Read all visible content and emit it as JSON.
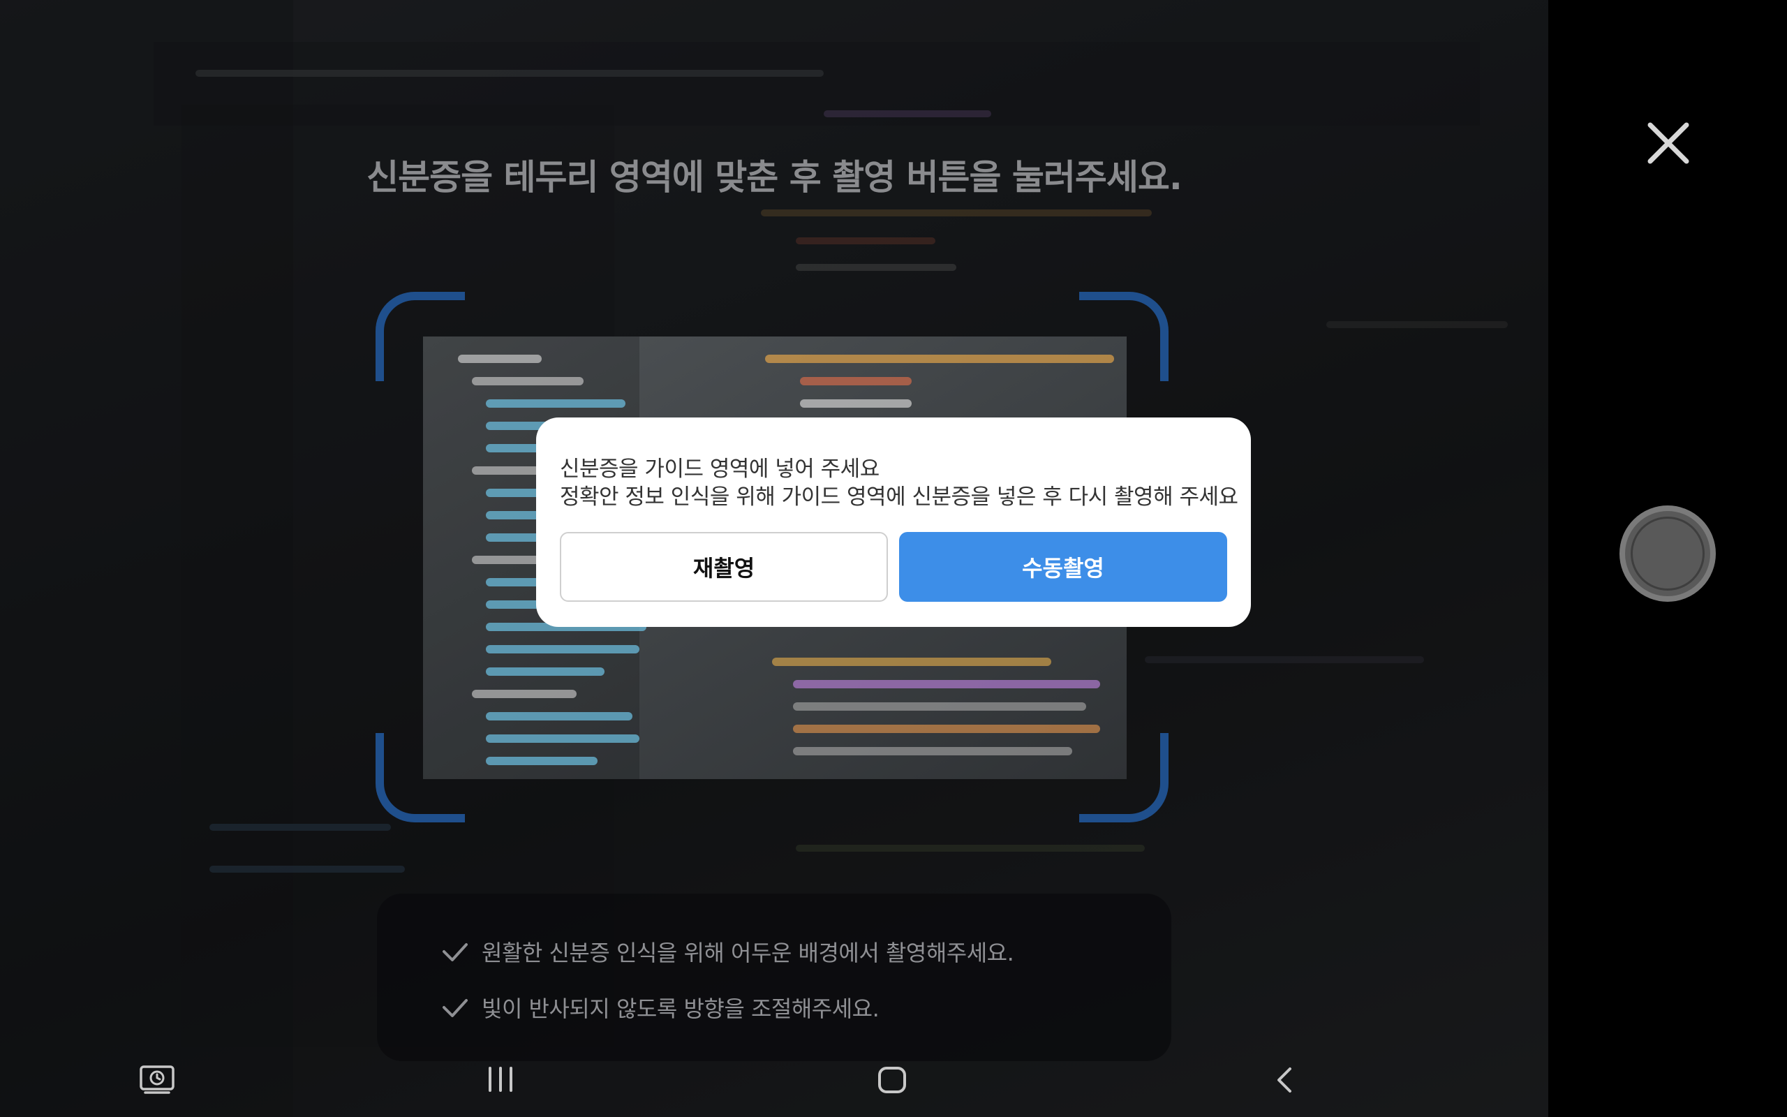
{
  "instruction": "신분증을 테두리 영역에 맞춘 후 촬영 버튼을 눌러주세요.",
  "dialog": {
    "title": "신분증을 가이드 영역에 넣어 주세요",
    "description": "정확안 정보 인식을 위해 가이드 영역에 신분증을 넣은 후 다시 촬영해 주세요",
    "retake_label": "재촬영",
    "manual_label": "수동촬영"
  },
  "tips": [
    "원활한 신분증 인식을 위해 어두운 배경에서 촬영해주세요.",
    "빛이 반사되지 않도록 방향을 조절해주세요."
  ],
  "controls": {
    "close_icon": "close-icon",
    "shutter": "shutter-button"
  },
  "navbar": {
    "icons": [
      "screen-capture-icon",
      "recent-apps-icon",
      "home-icon",
      "back-icon"
    ]
  },
  "colors": {
    "guide_corner": "#1f4f8c",
    "primary_button": "#3d8ee8",
    "instruction_text": "#8a8b8e",
    "tip_text": "#8f9094"
  }
}
